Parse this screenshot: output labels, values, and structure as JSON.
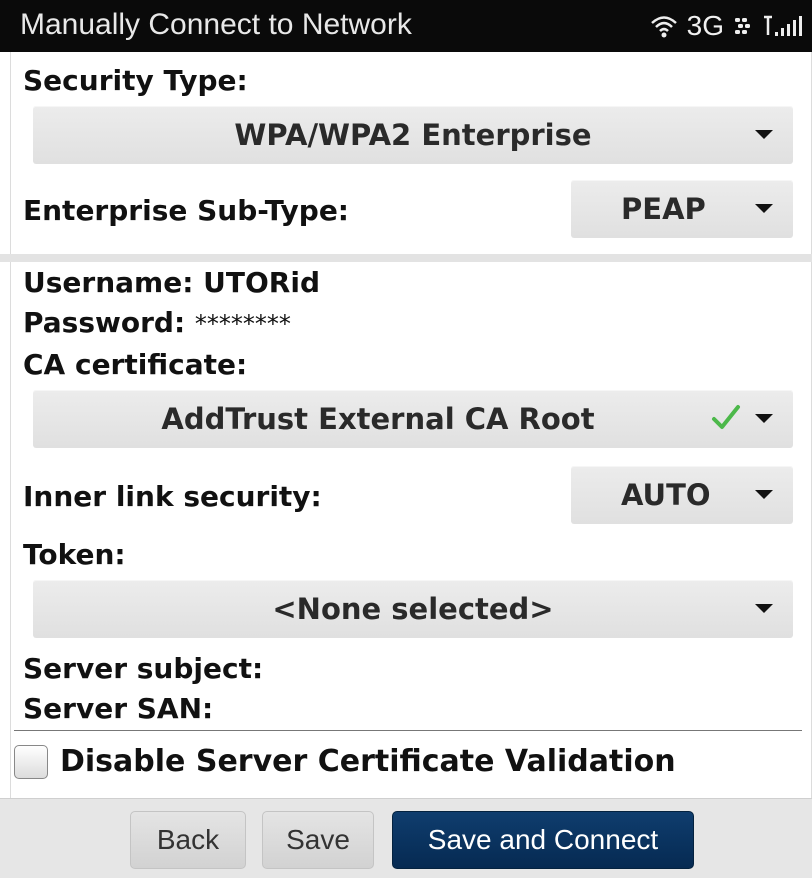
{
  "titlebar": {
    "title": "Manually Connect to Network",
    "network": "3G",
    "icons": [
      "wifi-icon",
      "blackberry-messenger-icon",
      "signal-strength-icon"
    ]
  },
  "security": {
    "type_label": "Security Type:",
    "type_value": "WPA/WPA2 Enterprise",
    "subtype_label": "Enterprise Sub-Type:",
    "subtype_value": "PEAP"
  },
  "credentials": {
    "username_label": "Username:",
    "username_value": "UTORid",
    "password_label": "Password:",
    "password_value": "********",
    "ca_label": "CA certificate:",
    "ca_value": "AddTrust External CA Root",
    "inner_label": "Inner link security:",
    "inner_value": "AUTO",
    "token_label": "Token:",
    "token_value": "<None selected>",
    "server_subject_label": "Server subject:",
    "server_san_label": "Server SAN:",
    "disable_validation_label": "Disable Server Certificate Validation",
    "disable_validation_checked": false
  },
  "buttons": {
    "back": "Back",
    "save": "Save",
    "save_connect": "Save and Connect"
  },
  "colors": {
    "titlebar_bg": "#0a0a0a",
    "primary_button": "#0a3563",
    "check": "#4cb84a"
  }
}
